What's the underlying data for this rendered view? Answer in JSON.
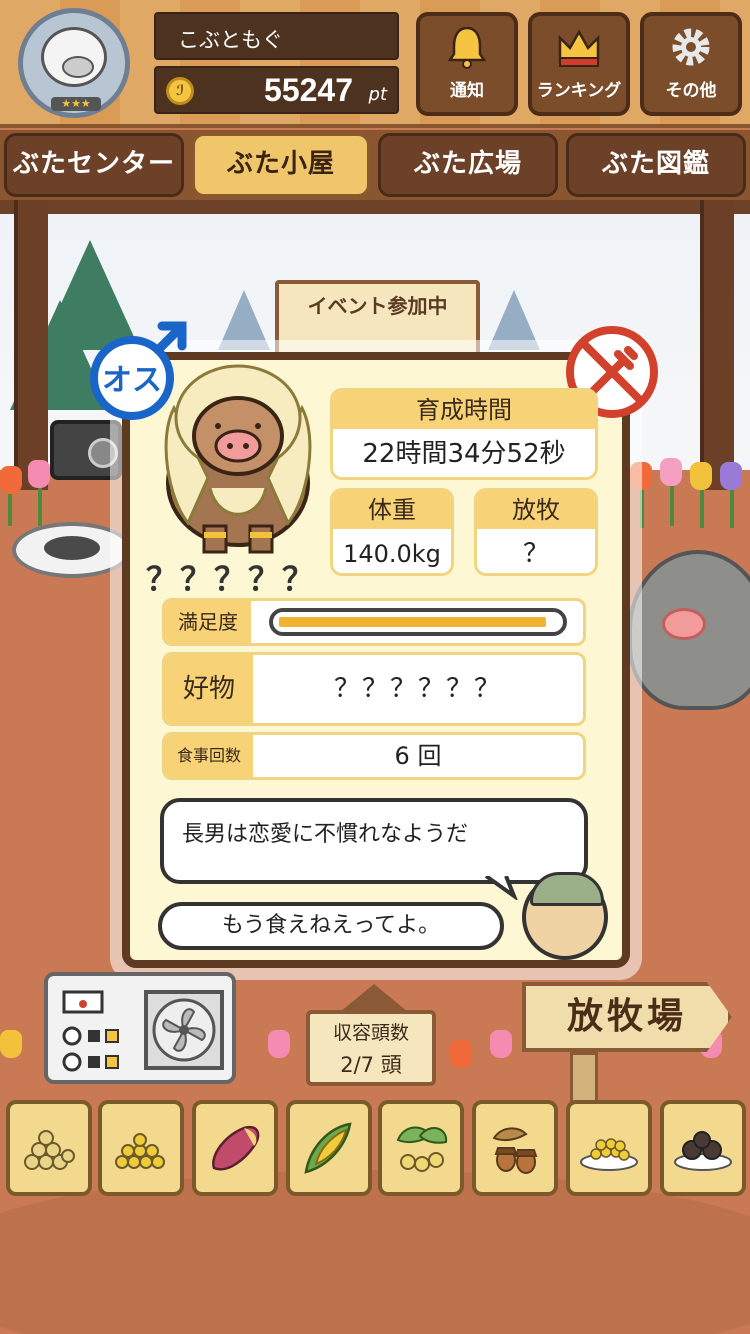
{
  "header": {
    "username": "こぶともぐ",
    "points_value": "55247",
    "points_unit": "pt",
    "coin_symbol": "ℐ",
    "avatar_stars": "★★★",
    "buttons": [
      {
        "label": "通知",
        "icon": "bell-icon"
      },
      {
        "label": "ランキング",
        "icon": "crown-icon"
      },
      {
        "label": "その他",
        "icon": "gear-icon"
      }
    ]
  },
  "tabs": [
    {
      "label": "ぶたセンター",
      "active": false
    },
    {
      "label": "ぶた小屋",
      "active": true
    },
    {
      "label": "ぶた広場",
      "active": false
    },
    {
      "label": "ぶた図鑑",
      "active": false
    }
  ],
  "background": {
    "event_sign": "イベント参加中"
  },
  "pig_card": {
    "sex_label": "オス",
    "name": "？？？？？",
    "growth_time": {
      "label": "育成時間",
      "value": "22時間34分52秒"
    },
    "weight": {
      "label": "体重",
      "value": "140.0kg"
    },
    "grazing": {
      "label": "放牧",
      "value": "？"
    },
    "satisfaction": {
      "label": "満足度",
      "level": 0.96
    },
    "favorite": {
      "label": "好物",
      "value": "？？？？？？"
    },
    "meals": {
      "label": "食事回数",
      "value": "6 回"
    },
    "message": "長男は恋愛に不慣れなようだ",
    "farmer_speech": "もう食えねえってよ。"
  },
  "bottom": {
    "capacity_label": "収容頭数",
    "capacity_value": "2/7 頭",
    "pasture_button": "放牧場",
    "food_items": [
      "soybeans-icon",
      "corn-kernels-icon",
      "sweet-potato-icon",
      "corn-cob-icon",
      "ginkgo-nuts-icon",
      "acorns-icon",
      "bean-plate-icon",
      "dark-dumplings-icon"
    ]
  },
  "colors": {
    "wood_dark": "#5e3a22",
    "card_bg": "#fdf7d3",
    "label_yellow": "#f7d277",
    "male_blue": "#1a66c8",
    "forbid_red": "#d2412b",
    "satisfaction_fill": "#f0b431"
  }
}
